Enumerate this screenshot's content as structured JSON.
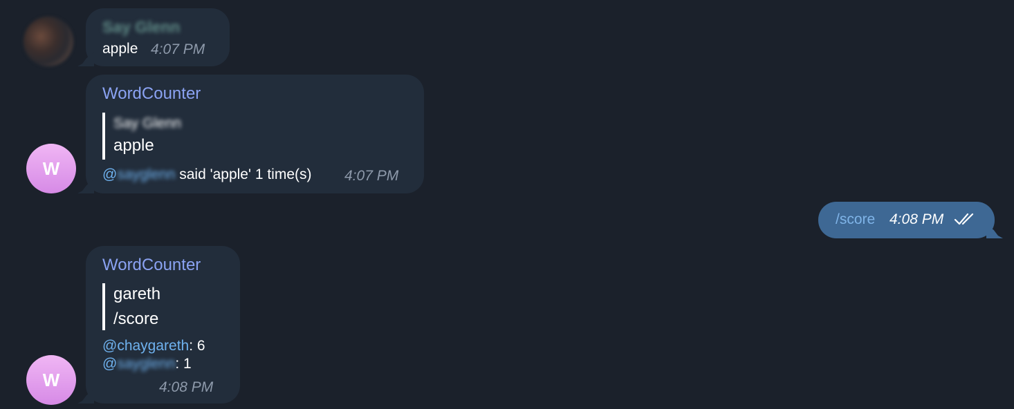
{
  "messages": [
    {
      "sender": "Say Glenn",
      "text": "apple",
      "time": "4:07 PM"
    },
    {
      "sender": "WordCounter",
      "avatar_letter": "W",
      "quote": {
        "author": "Say Glenn",
        "text": "apple"
      },
      "body": {
        "at": "@",
        "mention": "sayglenn",
        "rest": " said 'apple' 1 time(s)"
      },
      "time": "4:07 PM"
    },
    {
      "text": "/score",
      "time": "4:08 PM",
      "status_icon": "double-check-icon"
    },
    {
      "sender": "WordCounter",
      "avatar_letter": "W",
      "quote": {
        "line1": "gareth",
        "line2": "/score"
      },
      "scores": [
        {
          "at": "@",
          "mention": "chaygareth",
          "value": ": 6"
        },
        {
          "at": "@",
          "mention": "sayglenn",
          "value": ": 1"
        }
      ],
      "time": "4:08 PM"
    }
  ],
  "colors": {
    "background": "#1b212b",
    "incoming_bubble": "#222d3b",
    "outgoing_bubble": "#3e6894",
    "sender_name": "#8ba3f3",
    "mention": "#6fb2ef",
    "avatar_gradient_top": "#f0b6f4",
    "avatar_gradient_bottom": "#d68ae6"
  }
}
